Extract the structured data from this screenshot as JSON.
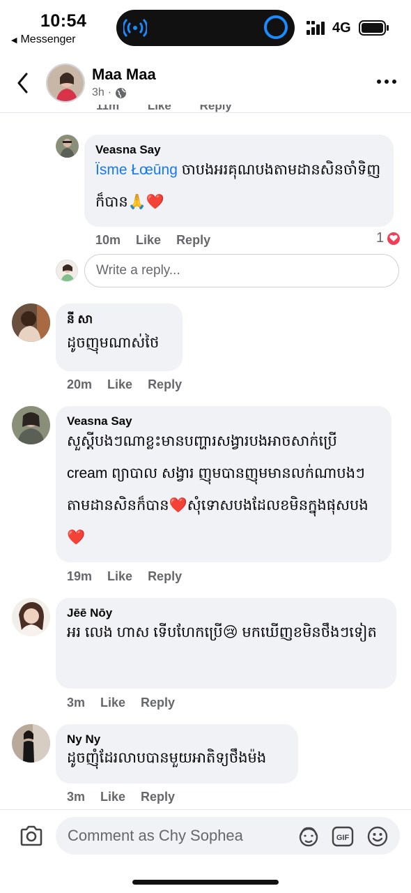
{
  "status_bar": {
    "time": "10:54",
    "back_app": "Messenger",
    "network": "4G",
    "icons": [
      "wifi-calling-icon",
      "screen-record-icon",
      "signal-icon",
      "battery-icon"
    ]
  },
  "header": {
    "name": "Maa Maa",
    "time": "3h",
    "audience_icon": "globe-icon"
  },
  "top_clipped_actions": {
    "time": "11m",
    "like": "Like",
    "reply": "Reply"
  },
  "comments": [
    {
      "name": "Veasna Say",
      "mention": "Ïsme Łœūng",
      "text": " ចាបងអរគុណបងតាមដានសិនចាំទិញក៏បាន🙏❤️",
      "time": "10m",
      "like": "Like",
      "reply": "Reply",
      "reaction_count": "1"
    },
    {
      "name": "នី សា",
      "text": "ដូចញុមណាស់ថៃ",
      "time": "20m",
      "like": "Like",
      "reply": "Reply"
    },
    {
      "name": "Veasna Say",
      "text": "សួស្តីបងៗណាខ្លះមានបញ្ហារសង្វារបងអាចសាក់ប្រើ cream ព្យាបាល សង្វារ ញុមបានញុមមានលក់ណាបងៗតាមដានសិនក៏បាន❤️សុំទោសបងដែលខមិនក្នុងផុសបង❤️",
      "time": "19m",
      "like": "Like",
      "reply": "Reply"
    },
    {
      "name": "Jēē Nōy",
      "text": "អរ លេង ហាស ទើបហែកប្រើ😢 មកឃើញខមិនថឹងៗទៀត",
      "time": "3m",
      "like": "Like",
      "reply": "Reply"
    },
    {
      "name": "Ny Ny",
      "text": "ដូចញុំដែរលាបបានមួយអាតិទ្យថឹងម៉ង",
      "time": "3m",
      "like": "Like",
      "reply": "Reply"
    }
  ],
  "reply_box": {
    "placeholder": "Write a reply..."
  },
  "bottom_bar": {
    "placeholder": "Comment as Chy Sophea",
    "icons": [
      "camera-icon",
      "avatar-sticker-icon",
      "gif-icon",
      "emoji-icon"
    ]
  },
  "colors": {
    "accent": "#1877f2",
    "bubble": "#f0f2f5",
    "secondary_text": "#65676b",
    "heart": "#f33e58"
  }
}
